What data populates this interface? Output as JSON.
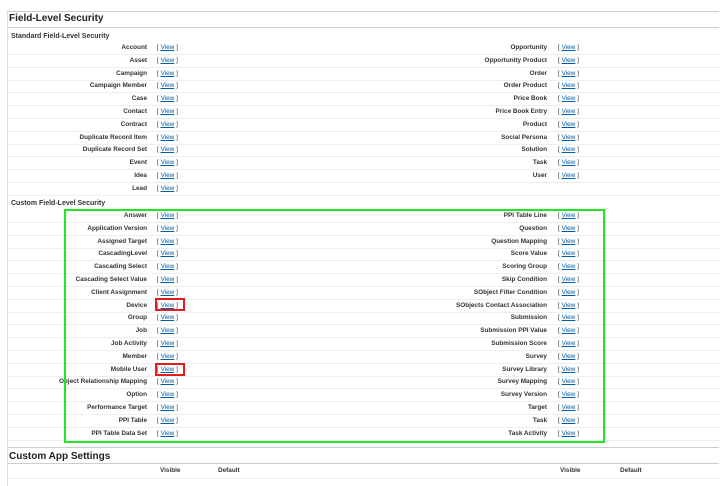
{
  "page": {
    "title": "Field-Level Security",
    "view_label": "View"
  },
  "standard": {
    "title": "Standard Field-Level Security",
    "left": [
      "Account",
      "Asset",
      "Campaign",
      "Campaign Member",
      "Case",
      "Contact",
      "Contract",
      "Duplicate Record Item",
      "Duplicate Record Set",
      "Event",
      "Idea",
      "Lead"
    ],
    "right": [
      "Opportunity",
      "Opportunity Product",
      "Order",
      "Order Product",
      "Price Book",
      "Price Book Entry",
      "Product",
      "Social Persona",
      "Solution",
      "Task",
      "User"
    ]
  },
  "custom": {
    "title": "Custom Field-Level Security",
    "left": [
      "Answer",
      "Application Version",
      "Assigned Target",
      "CascadingLevel",
      "Cascading Select",
      "Cascading Select Value",
      "Client Assignment",
      "Device",
      "Group",
      "Job",
      "Job Activity",
      "Member",
      "Mobile User",
      "Object Relationship Mapping",
      "Option",
      "Performance Target",
      "PPI Table",
      "PPI Table Data Set"
    ],
    "right": [
      "PPI Table Line",
      "Question",
      "Question Mapping",
      "Score Value",
      "Scoring Group",
      "Skip Condition",
      "SObject Filter Condition",
      "SObjects Contact Association",
      "Submission",
      "Submission PPI Value",
      "Submission Score",
      "Survey",
      "Survey Library",
      "Survey Mapping",
      "Survey Version",
      "Target",
      "Task",
      "Task Activity"
    ]
  },
  "app_settings": {
    "title": "Custom App Settings",
    "col_visible": "Visible",
    "col_default": "Default"
  },
  "colors": {
    "highlight_group": "#22e622",
    "highlight_item": "#e41c1c",
    "link": "#015ba7"
  }
}
